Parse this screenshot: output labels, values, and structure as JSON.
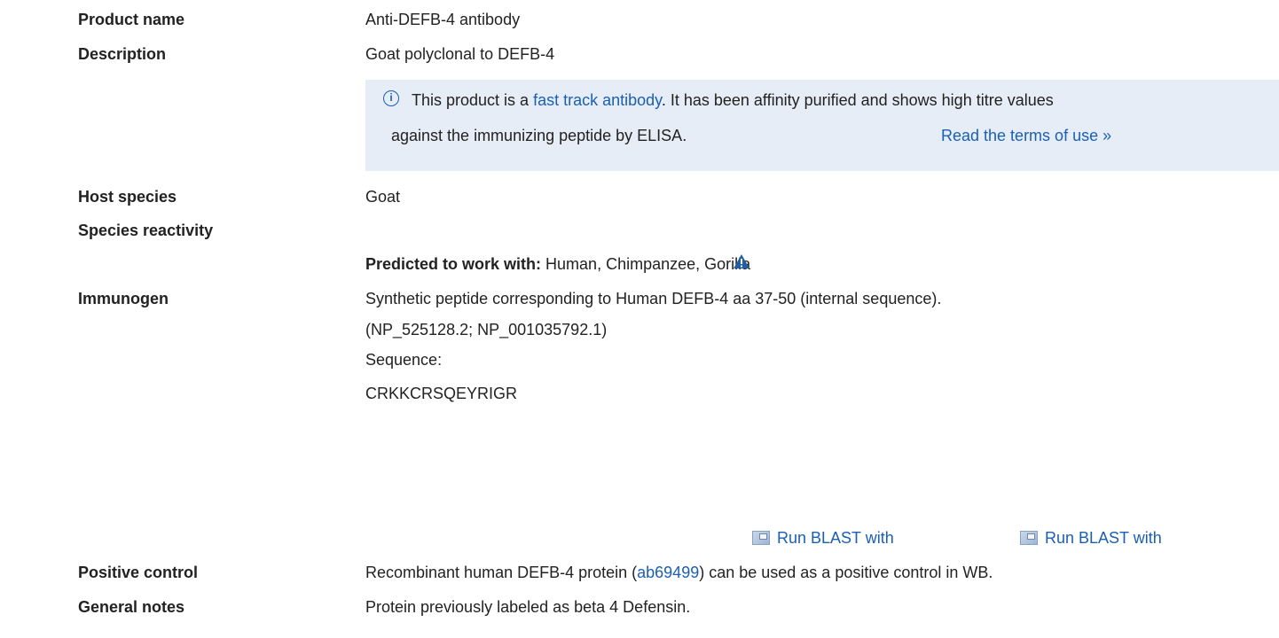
{
  "fields": {
    "product_name": {
      "label": "Product name",
      "value": "Anti-DEFB-4 antibody"
    },
    "description": {
      "label": "Description",
      "value": "Goat polyclonal to DEFB-4"
    },
    "host_species": {
      "label": "Host species",
      "value": "Goat"
    },
    "species_reactivity": {
      "label": "Species reactivity"
    },
    "predicted": {
      "label": "Predicted to work with:",
      "value": "Human, Chimpanzee, Gorilla"
    },
    "immunogen": {
      "label": "Immunogen",
      "line1": "Synthetic peptide corresponding to Human DEFB-4 aa 37-50 (internal sequence).",
      "line2": "(NP_525128.2; NP_001035792.1)",
      "sequence_label": "Sequence:",
      "sequence": "CRKKCRSQEYRIGR"
    },
    "positive_control": {
      "label": "Positive control",
      "pre": "Recombinant human DEFB-4 protein (",
      "link": "ab69499",
      "post": ") can be used as a positive control in WB."
    },
    "general_notes": {
      "label": "General notes",
      "value": "Protein previously labeled as beta 4 Defensin."
    }
  },
  "note": {
    "pre": "This product is a ",
    "link": "fast track antibody",
    "post": ". It has been affinity purified and shows high titre values",
    "line2": "against the immunizing peptide by ELISA.",
    "terms_link": "Read the terms of use »"
  },
  "blast": {
    "left_label": "Run BLAST with",
    "right_label": "Run BLAST with"
  },
  "icons": {
    "info": "info-icon",
    "warning": "warning-icon",
    "blast": "external-link-icon"
  },
  "colors": {
    "link": "#1a5fb4",
    "note_bg": "#e6edf6",
    "warning": "#1f5ea8"
  }
}
